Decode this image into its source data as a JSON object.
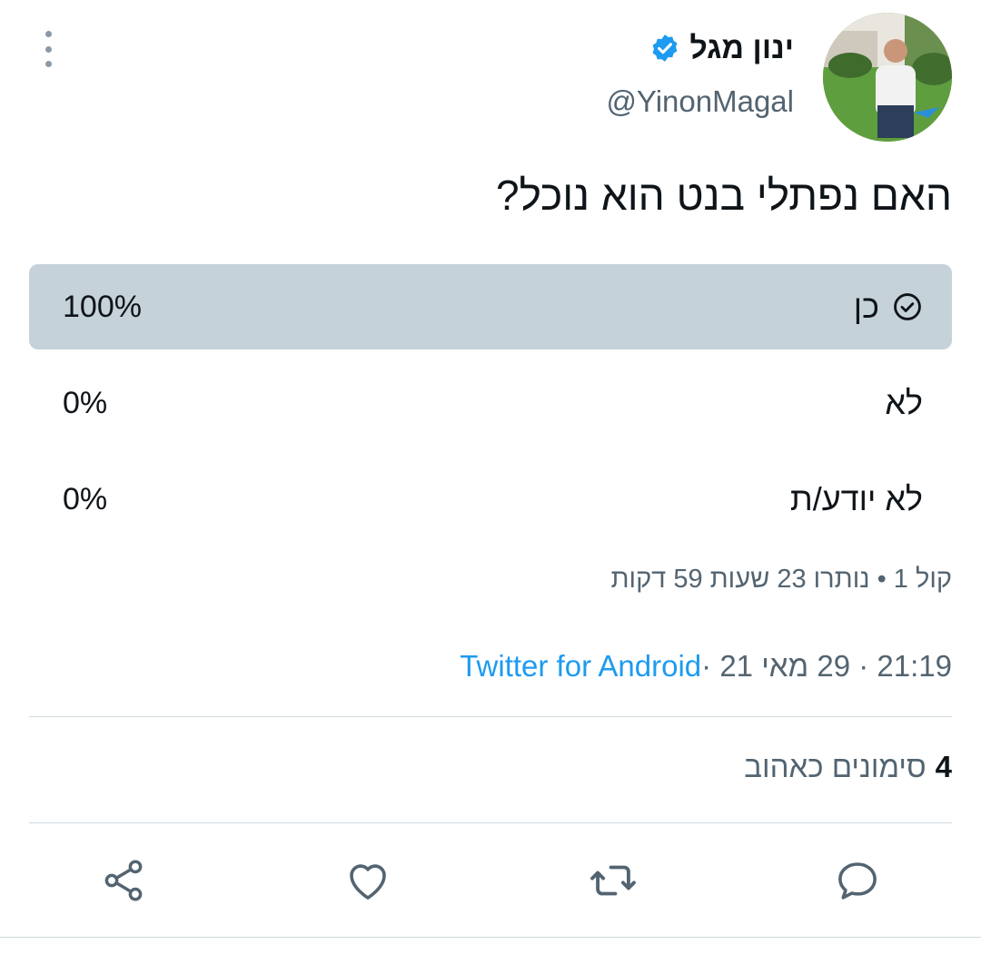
{
  "tweet": {
    "author_name": "ינון מגל",
    "author_handle": "@YinonMagal",
    "verified_icon": "verified-badge-icon",
    "text": "האם נפתלי בנט הוא נוכל?"
  },
  "poll": {
    "options": [
      {
        "label": "כן",
        "percent_text": "100%",
        "share": 1.0,
        "selected": true
      },
      {
        "label": "לא",
        "percent_text": "0%",
        "share": 0.0,
        "selected": false
      },
      {
        "label": "לא יודע/ת",
        "percent_text": "0%",
        "share": 0.0,
        "selected": false
      }
    ],
    "summary": "קול 1 • נותרו 23 שעות 59 דקות"
  },
  "meta": {
    "time_date": "21:19 · 29 מאי 21 · ",
    "source": "Twitter for Android"
  },
  "stats": {
    "likes_count": "4",
    "likes_label": "סימונים כאהוב"
  },
  "actions": [
    "reply-icon",
    "retweet-icon",
    "like-icon",
    "share-icon"
  ],
  "colors": {
    "poll_fill": "#c6d2d9",
    "verified": "#1d9bf0",
    "link": "#1d9bf0",
    "secondary_text": "#536471"
  }
}
